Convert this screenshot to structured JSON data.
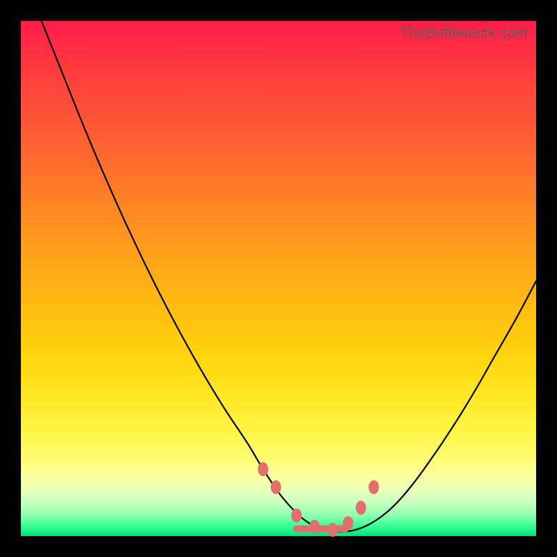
{
  "watermark": "TheBottleneck.com",
  "chart_data": {
    "type": "line",
    "title": "",
    "xlabel": "",
    "ylabel": "",
    "xlim": [
      0,
      100
    ],
    "ylim": [
      0,
      100
    ],
    "grid": false,
    "legend": false,
    "annotations": [],
    "series": [
      {
        "name": "bottleneck-curve",
        "x": [
          4,
          8,
          12,
          16,
          20,
          24,
          28,
          32,
          36,
          40,
          44,
          47,
          50,
          53,
          56,
          60,
          64,
          68,
          72,
          76,
          80,
          84,
          88,
          92,
          96,
          100
        ],
        "y": [
          100,
          90,
          80,
          70.5,
          61.5,
          53,
          45,
          37.5,
          30.5,
          24,
          18,
          13,
          8.5,
          5,
          2.5,
          1,
          1,
          2.5,
          5.5,
          10,
          15.5,
          21.5,
          28,
          35,
          42,
          49.5
        ]
      }
    ],
    "markers": {
      "name": "highlight-points",
      "color": "#e26f6b",
      "points_x": [
        47,
        49.5,
        53.5,
        57,
        60.5,
        63.5,
        66,
        68.5
      ],
      "points_y": [
        13,
        9.5,
        4,
        1.8,
        1.2,
        2.5,
        5.5,
        9.5
      ]
    },
    "flat_bottom": {
      "x_start": 53.5,
      "x_end": 63,
      "y": 1.4
    }
  }
}
